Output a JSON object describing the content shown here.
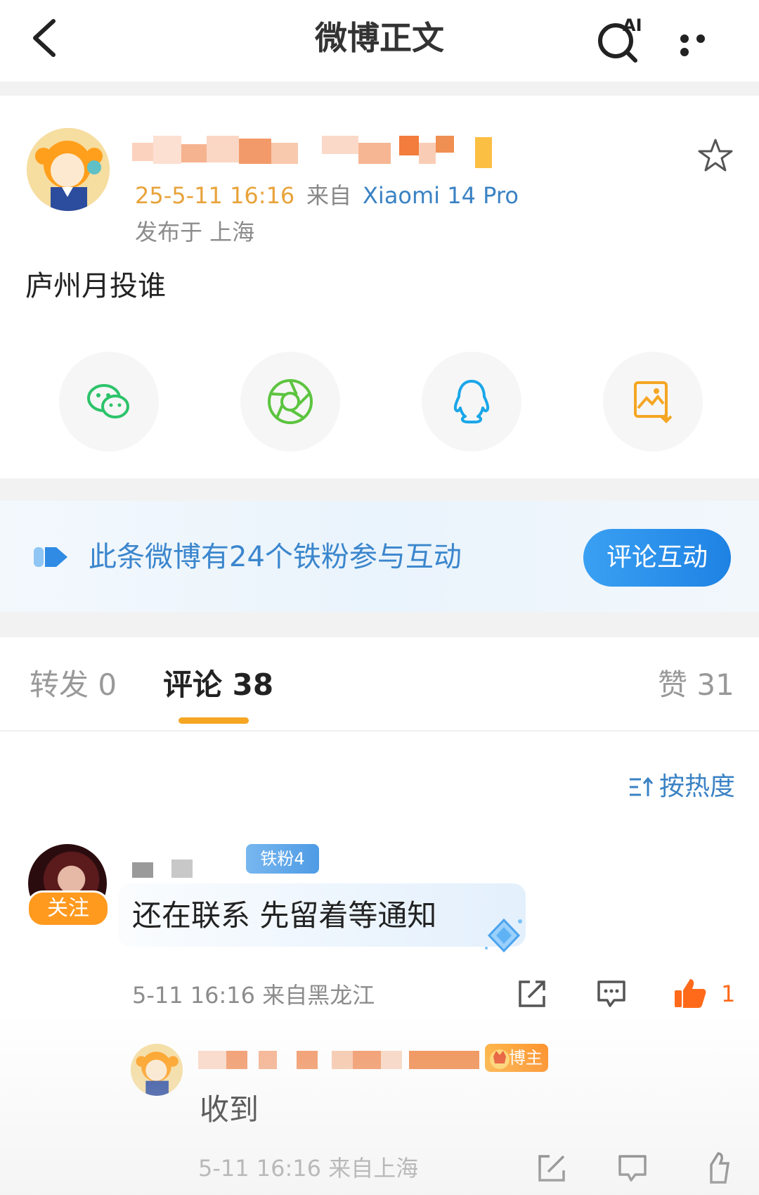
{
  "nav": {
    "title": "微博正文",
    "back_icon": "chevron-left-icon",
    "ai_icon": "ai-search-icon",
    "ai_label": "AI",
    "more_icon": "more-dots-icon"
  },
  "post": {
    "author_name": "",
    "time": "25-5-11 16:16",
    "from_prefix": "来自",
    "device": "Xiaomi 14 Pro",
    "location": "发布于 上海",
    "text": "庐州月投谁",
    "favorite_icon": "star-outline-icon"
  },
  "share": [
    {
      "name": "wechat-icon",
      "color": "#2dc36a"
    },
    {
      "name": "moments-icon",
      "color": "#5cc43f"
    },
    {
      "name": "qq-icon",
      "color": "#1aa6e8"
    },
    {
      "name": "save-image-icon",
      "color": "#f5a623"
    }
  ],
  "banner": {
    "text": "此条微博有24个铁粉参与互动",
    "button": "评论互动"
  },
  "tabs": {
    "repost": "转发 0",
    "comment": "评论 38",
    "like": "赞 31"
  },
  "sort": {
    "label": "按热度"
  },
  "comment": {
    "follow": "关注",
    "fan_badge": "铁粉4",
    "text": "还在联系 先留着等通知",
    "meta": "5-11 16:16 来自黑龙江",
    "like_count": "1"
  },
  "reply": {
    "badge": "博主",
    "text": "收到",
    "meta": "5-11 16:16 来自上海"
  },
  "colors": {
    "accent_orange": "#f5a623",
    "link_blue": "#3a82c4",
    "like_orange": "#ff6a1a"
  }
}
